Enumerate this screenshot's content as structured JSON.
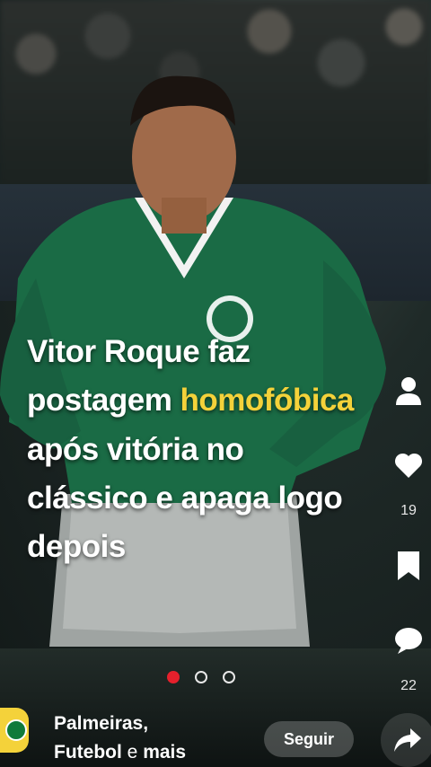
{
  "headline": {
    "part1": "Vitor Roque faz postagem ",
    "highlight": "homofóbica",
    "part2": " após vitória no clássico e apaga logo depois"
  },
  "rail": {
    "likes": "19",
    "comments": "22"
  },
  "carousel": {
    "current": 1,
    "total": 3
  },
  "channel": {
    "name_bold_1": "Palmeiras,",
    "name_bold_2": "Futebol",
    "name_light": " e ",
    "name_bold_3": "mais"
  },
  "follow_label": "Seguir",
  "colors": {
    "highlight": "#f4d23a",
    "accent": "#e5202c",
    "jersey": "#1a6b45"
  }
}
